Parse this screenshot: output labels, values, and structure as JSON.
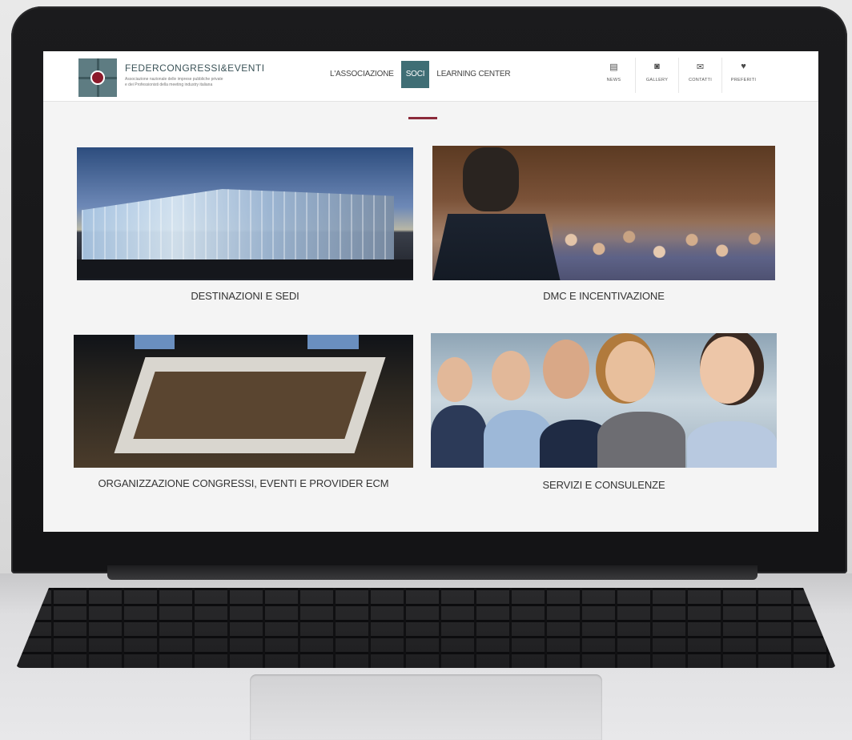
{
  "site": {
    "logo": {
      "name": "FEDERCONGRESSI&EVENTI",
      "subtitle_lines": [
        "Associazione nazionale delle imprese pubbliche private",
        "e dei Professionisti della meeting industry italiana"
      ]
    },
    "main_nav": [
      "L'ASSOCIAZIONE",
      "SOCI",
      "LEARNING CENTER"
    ],
    "util_nav": [
      {
        "label": "NEWS",
        "icon": "newspaper-icon"
      },
      {
        "label": "GALLERY",
        "icon": "camera-icon"
      },
      {
        "label": "CONTATTI",
        "icon": "envelope-icon"
      },
      {
        "label": "PREFERITI",
        "icon": "heart-icon"
      }
    ],
    "accent_color": "#8b2a3a",
    "nav_active_color": "#3f6e75"
  },
  "cards": [
    {
      "caption": "DESTINAZIONI E SEDI"
    },
    {
      "caption": "DMC E INCENTIVAZIONE"
    },
    {
      "caption": "ORGANIZZAZIONE CONGRESSI, EVENTI E PROVIDER ECM"
    },
    {
      "caption": "SERVIZI E CONSULENZE"
    }
  ]
}
